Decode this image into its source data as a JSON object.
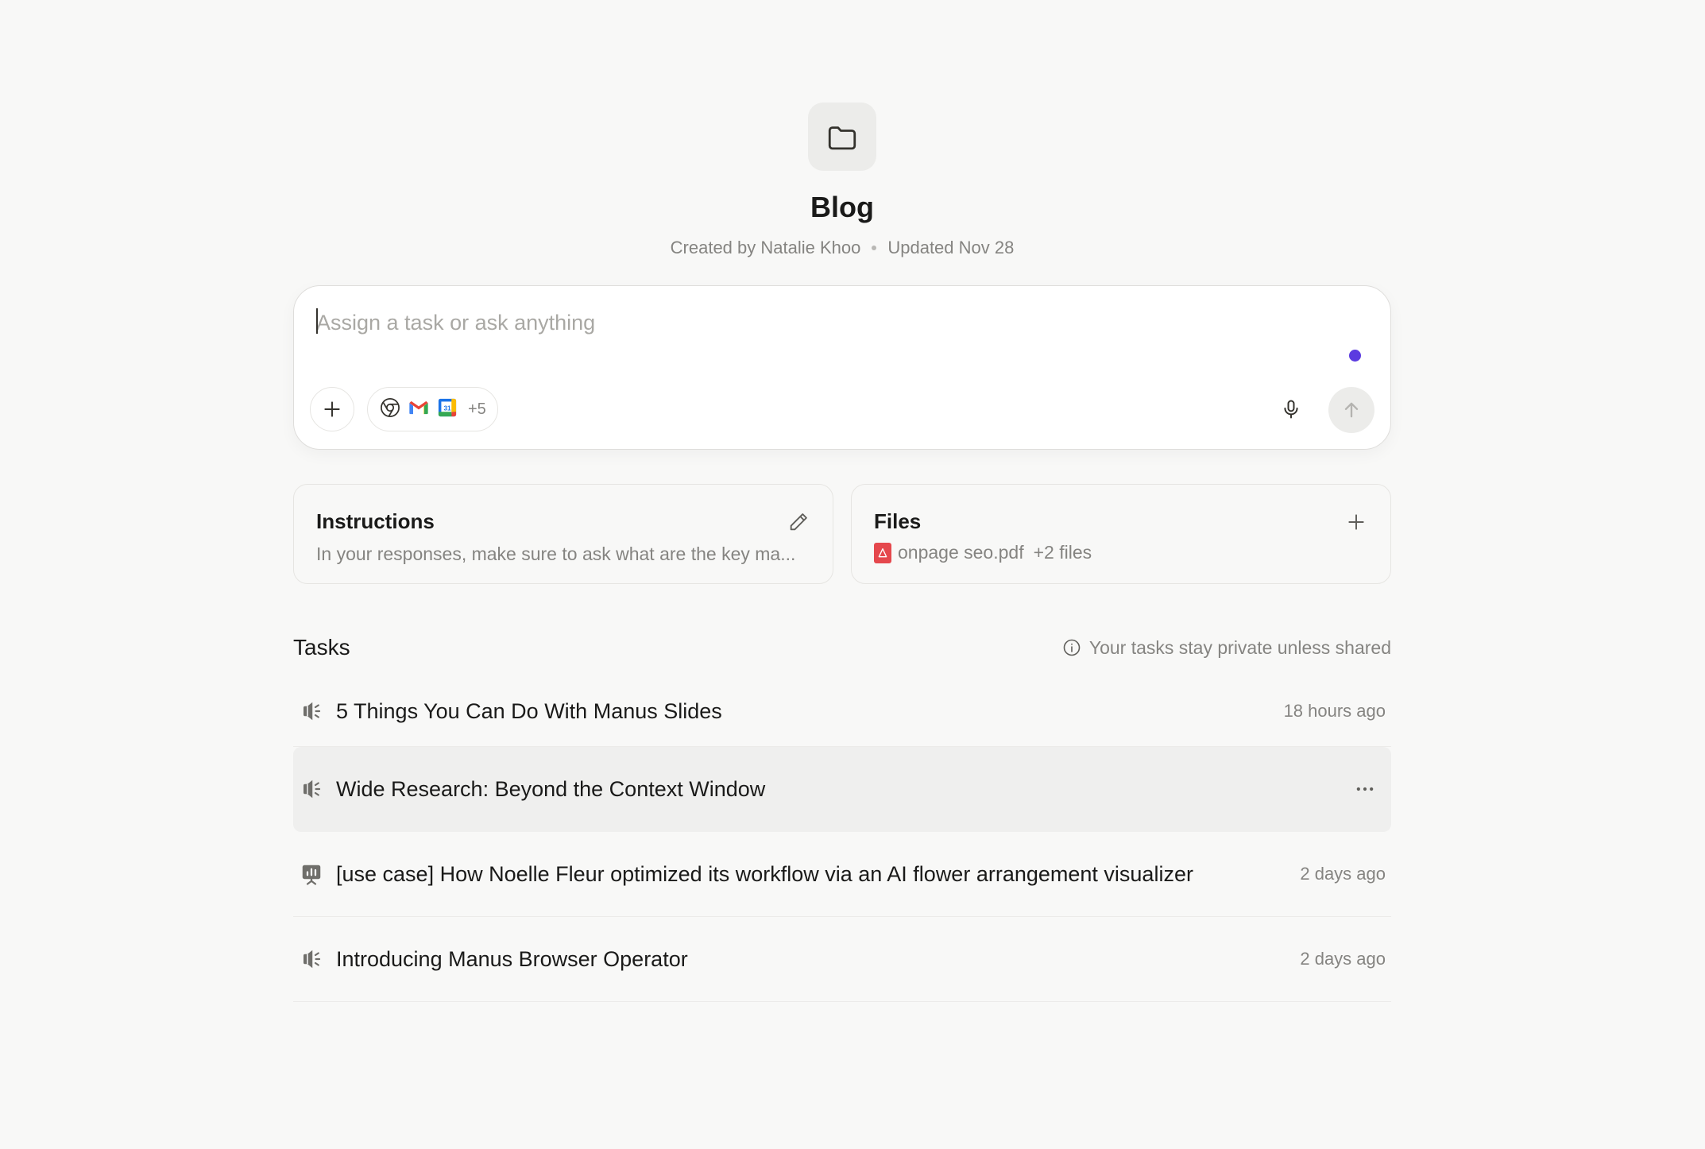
{
  "project": {
    "title": "Blog",
    "created_by": "Created by Natalie Khoo",
    "updated": "Updated Nov 28",
    "icon": "folder-icon"
  },
  "composer": {
    "placeholder": "Assign a task or ask anything",
    "value": "",
    "connectors": [
      "chrome-icon",
      "gmail-icon",
      "google-calendar-icon"
    ],
    "connectors_more": "+5",
    "accent_dot_color": "#5b3be0"
  },
  "instructions": {
    "title": "Instructions",
    "text": "In your responses, make sure to ask what are the key ma..."
  },
  "files": {
    "title": "Files",
    "file_name": "onpage seo.pdf",
    "more": "+2 files"
  },
  "tasks": {
    "title": "Tasks",
    "privacy_note": "Your tasks stay private unless shared",
    "items": [
      {
        "title": "5 Things You Can Do With Manus Slides",
        "time": "18 hours ago",
        "icon": "megaphone-icon"
      },
      {
        "title": "Wide Research: Beyond the Context Window",
        "time": "",
        "icon": "megaphone-icon"
      },
      {
        "title": "[use case] How Noelle Fleur optimized its workflow via an AI flower arrangement visualizer",
        "time": "2 days ago",
        "icon": "presentation-icon"
      },
      {
        "title": "Introducing Manus Browser Operator",
        "time": "2 days ago",
        "icon": "megaphone-icon"
      }
    ]
  }
}
